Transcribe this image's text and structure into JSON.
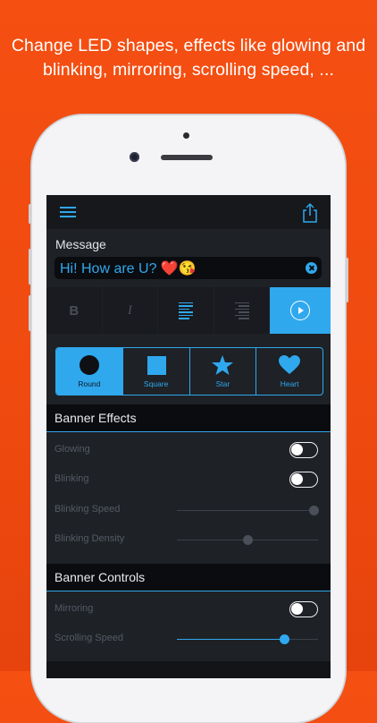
{
  "headline": {
    "line1": "Change LED shapes, effects like glowing and",
    "line2": "blinking, mirroring, scrolling speed, ..."
  },
  "topbar": {
    "menu_icon": "hamburger-icon",
    "share_icon": "share-icon"
  },
  "message": {
    "label": "Message",
    "value": "Hi! How are U? ❤️😘",
    "clear_icon": "clear-icon"
  },
  "format_buttons": {
    "bold": "B",
    "italic": "I",
    "align_left_icon": "align-left-icon",
    "align_right_icon": "align-right-icon",
    "play_icon": "play-icon"
  },
  "shapes": [
    {
      "label": "Round",
      "icon": "circle-icon",
      "selected": true
    },
    {
      "label": "Square",
      "icon": "square-icon",
      "selected": false
    },
    {
      "label": "Star",
      "icon": "star-icon",
      "selected": false
    },
    {
      "label": "Heart",
      "icon": "heart-icon",
      "selected": false
    }
  ],
  "banner_effects": {
    "title": "Banner Effects",
    "glowing": {
      "label": "Glowing",
      "on": false
    },
    "blinking": {
      "label": "Blinking",
      "on": false
    },
    "blinking_speed": {
      "label": "Blinking Speed",
      "value": 0.97
    },
    "blinking_density": {
      "label": "Blinking Density",
      "value": 0.5
    }
  },
  "banner_controls": {
    "title": "Banner Controls",
    "mirroring": {
      "label": "Mirroring",
      "on": false
    },
    "scrolling_speed": {
      "label": "Scrolling Speed",
      "value": 0.76
    }
  },
  "colors": {
    "background": "#f54f12",
    "accent": "#2fa8ee",
    "screen_bg": "#1e2126",
    "muted_text": "#555a64"
  }
}
